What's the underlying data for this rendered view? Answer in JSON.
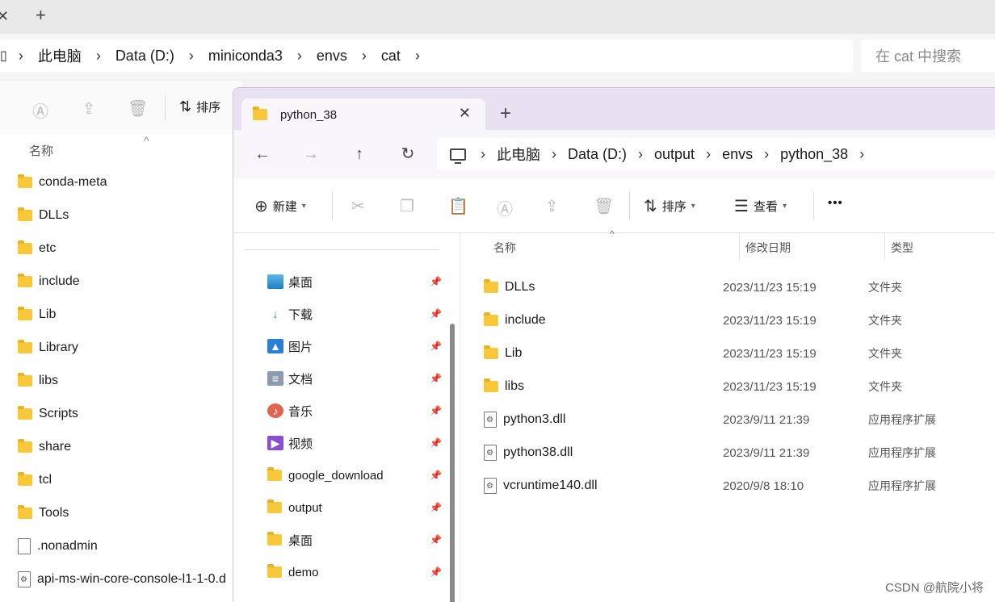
{
  "background_window": {
    "address": [
      "此电脑",
      "Data (D:)",
      "miniconda3",
      "envs",
      "cat"
    ],
    "search_placeholder": "在 cat 中搜索",
    "toolbar": {
      "sort_label": "排序"
    },
    "column_name": "名称",
    "items": [
      {
        "name": "conda-meta",
        "kind": "folder"
      },
      {
        "name": "DLLs",
        "kind": "folder"
      },
      {
        "name": "etc",
        "kind": "folder"
      },
      {
        "name": "include",
        "kind": "folder"
      },
      {
        "name": "Lib",
        "kind": "folder"
      },
      {
        "name": "Library",
        "kind": "folder"
      },
      {
        "name": "libs",
        "kind": "folder"
      },
      {
        "name": "Scripts",
        "kind": "folder"
      },
      {
        "name": "share",
        "kind": "folder"
      },
      {
        "name": "tcl",
        "kind": "folder"
      },
      {
        "name": "Tools",
        "kind": "folder"
      },
      {
        "name": ".nonadmin",
        "kind": "file"
      },
      {
        "name": "api-ms-win-core-console-l1-1-0.d",
        "kind": "dll"
      }
    ]
  },
  "foreground_window": {
    "tab_title": "python_38",
    "address": [
      "此电脑",
      "Data (D:)",
      "output",
      "envs",
      "python_38"
    ],
    "toolbar": {
      "new_label": "新建",
      "sort_label": "排序",
      "view_label": "查看",
      "more_label": "•••"
    },
    "nav_items": [
      {
        "label": "桌面",
        "icon": "desktop-icon"
      },
      {
        "label": "下载",
        "icon": "download-icon"
      },
      {
        "label": "图片",
        "icon": "pictures-icon"
      },
      {
        "label": "文档",
        "icon": "documents-icon"
      },
      {
        "label": "音乐",
        "icon": "music-icon"
      },
      {
        "label": "视频",
        "icon": "videos-icon"
      },
      {
        "label": "google_download",
        "icon": "folder-icon"
      },
      {
        "label": "output",
        "icon": "folder-icon"
      },
      {
        "label": "桌面",
        "icon": "folder-icon"
      },
      {
        "label": "demo",
        "icon": "folder-icon"
      }
    ],
    "columns": {
      "name": "名称",
      "date": "修改日期",
      "type": "类型"
    },
    "files": [
      {
        "name": "DLLs",
        "date": "2023/11/23 15:19",
        "type": "文件夹",
        "kind": "folder"
      },
      {
        "name": "include",
        "date": "2023/11/23 15:19",
        "type": "文件夹",
        "kind": "folder"
      },
      {
        "name": "Lib",
        "date": "2023/11/23 15:19",
        "type": "文件夹",
        "kind": "folder"
      },
      {
        "name": "libs",
        "date": "2023/11/23 15:19",
        "type": "文件夹",
        "kind": "folder"
      },
      {
        "name": "python3.dll",
        "date": "2023/9/11 21:39",
        "type": "应用程序扩展",
        "kind": "dll"
      },
      {
        "name": "python38.dll",
        "date": "2023/9/11 21:39",
        "type": "应用程序扩展",
        "kind": "dll"
      },
      {
        "name": "vcruntime140.dll",
        "date": "2020/9/8 18:10",
        "type": "应用程序扩展",
        "kind": "dll"
      }
    ]
  },
  "watermark": "CSDN @航院小将"
}
